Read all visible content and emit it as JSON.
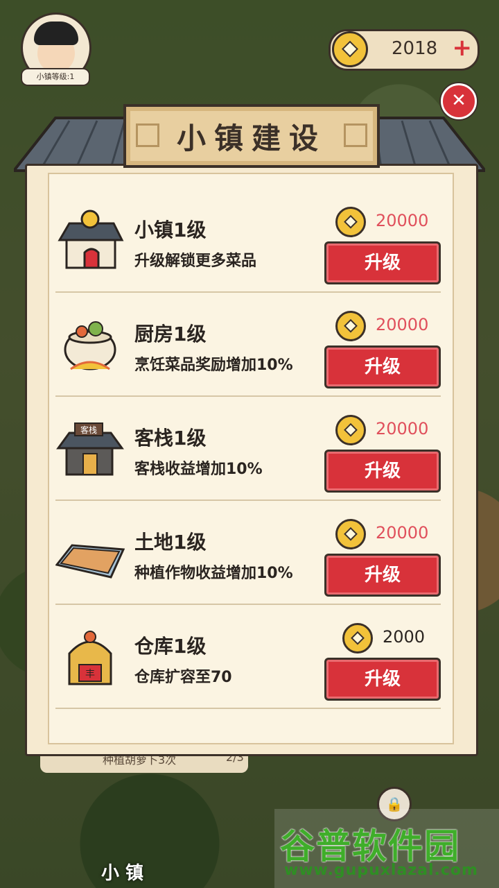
{
  "hud": {
    "level_label": "小镇等级:1",
    "coins": "2018",
    "add_symbol": "+"
  },
  "dialog": {
    "title": "小镇建设",
    "close_symbol": "✕",
    "rows": [
      {
        "name": "小镇1级",
        "desc": "升级解锁更多菜品",
        "cost": "20000",
        "button": "升级",
        "icon": "town-house-icon"
      },
      {
        "name": "厨房1级",
        "desc": "烹饪菜品奖励增加10%",
        "cost": "20000",
        "button": "升级",
        "icon": "cooking-pot-icon"
      },
      {
        "name": "客栈1级",
        "desc": "客栈收益增加10%",
        "cost": "20000",
        "button": "升级",
        "icon": "inn-icon",
        "sign": "客栈"
      },
      {
        "name": "土地1级",
        "desc": "种植作物收益增加10%",
        "cost": "20000",
        "button": "升级",
        "icon": "farmland-icon"
      },
      {
        "name": "仓库1级",
        "desc": "仓库扩容至70",
        "cost": "2000",
        "button": "升级",
        "icon": "warehouse-icon",
        "sign": "丰"
      }
    ]
  },
  "background": {
    "task_text": "种植胡萝卜3次",
    "task_progress": "2/3",
    "bottom_label": "小 镇"
  },
  "watermark": {
    "title": "谷普软件园",
    "url": "www.gupuxlazal.com"
  },
  "colors": {
    "accent_red": "#d8323a",
    "coin_gold": "#f2c23a",
    "cost_pink": "#e0505c",
    "panel_bg": "#f6ead0"
  }
}
